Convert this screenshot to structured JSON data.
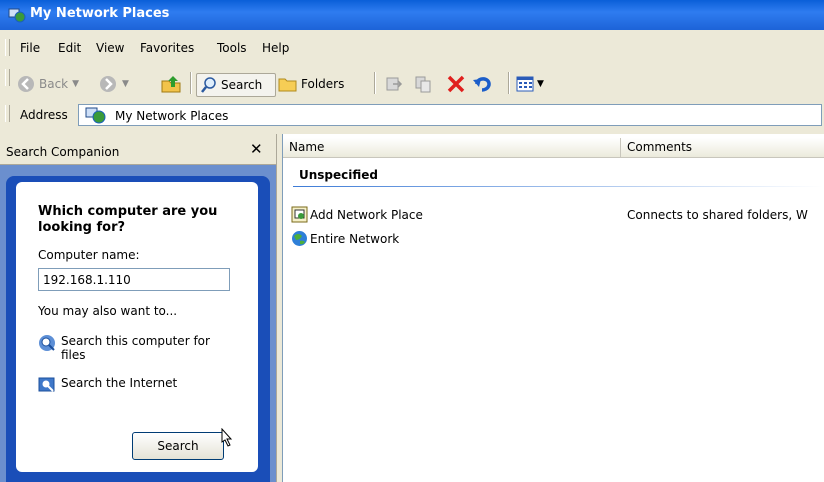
{
  "window": {
    "title": "My Network Places"
  },
  "menu": {
    "items": [
      {
        "label": "File"
      },
      {
        "label": "Edit"
      },
      {
        "label": "View"
      },
      {
        "label": "Favorites"
      },
      {
        "label": "Tools"
      },
      {
        "label": "Help"
      }
    ]
  },
  "toolbar": {
    "back_label": "Back",
    "search_label": "Search",
    "folders_label": "Folders"
  },
  "address": {
    "label": "Address",
    "value": "My Network Places"
  },
  "search_companion": {
    "title": "Search Companion",
    "question": "Which computer are you looking for?",
    "computer_name_label": "Computer name:",
    "computer_name_value": "192.168.1.110",
    "also_label": "You may also want to...",
    "link_files": "Search this computer for files",
    "link_internet": "Search the Internet",
    "search_button": "Search"
  },
  "list": {
    "columns": [
      "Name",
      "Comments"
    ],
    "group": "Unspecified",
    "rows": [
      {
        "name": "Add Network Place",
        "comment": "Connects to shared folders, W"
      },
      {
        "name": "Entire Network",
        "comment": ""
      }
    ]
  },
  "colors": {
    "titlebar": "#0a5fd8",
    "panel_bg": "#6b8fce",
    "panel_inner": "#1a4eb8",
    "chrome": "#ece9d8"
  },
  "icons": [
    "network-places-icon",
    "back-icon",
    "forward-icon",
    "up-folder-icon",
    "search-icon",
    "folders-icon",
    "move-to-icon",
    "copy-to-icon",
    "delete-icon",
    "undo-icon",
    "views-icon",
    "network-search-icon",
    "internet-search-icon",
    "add-network-place-icon",
    "entire-network-icon",
    "mouse-cursor-icon"
  ]
}
